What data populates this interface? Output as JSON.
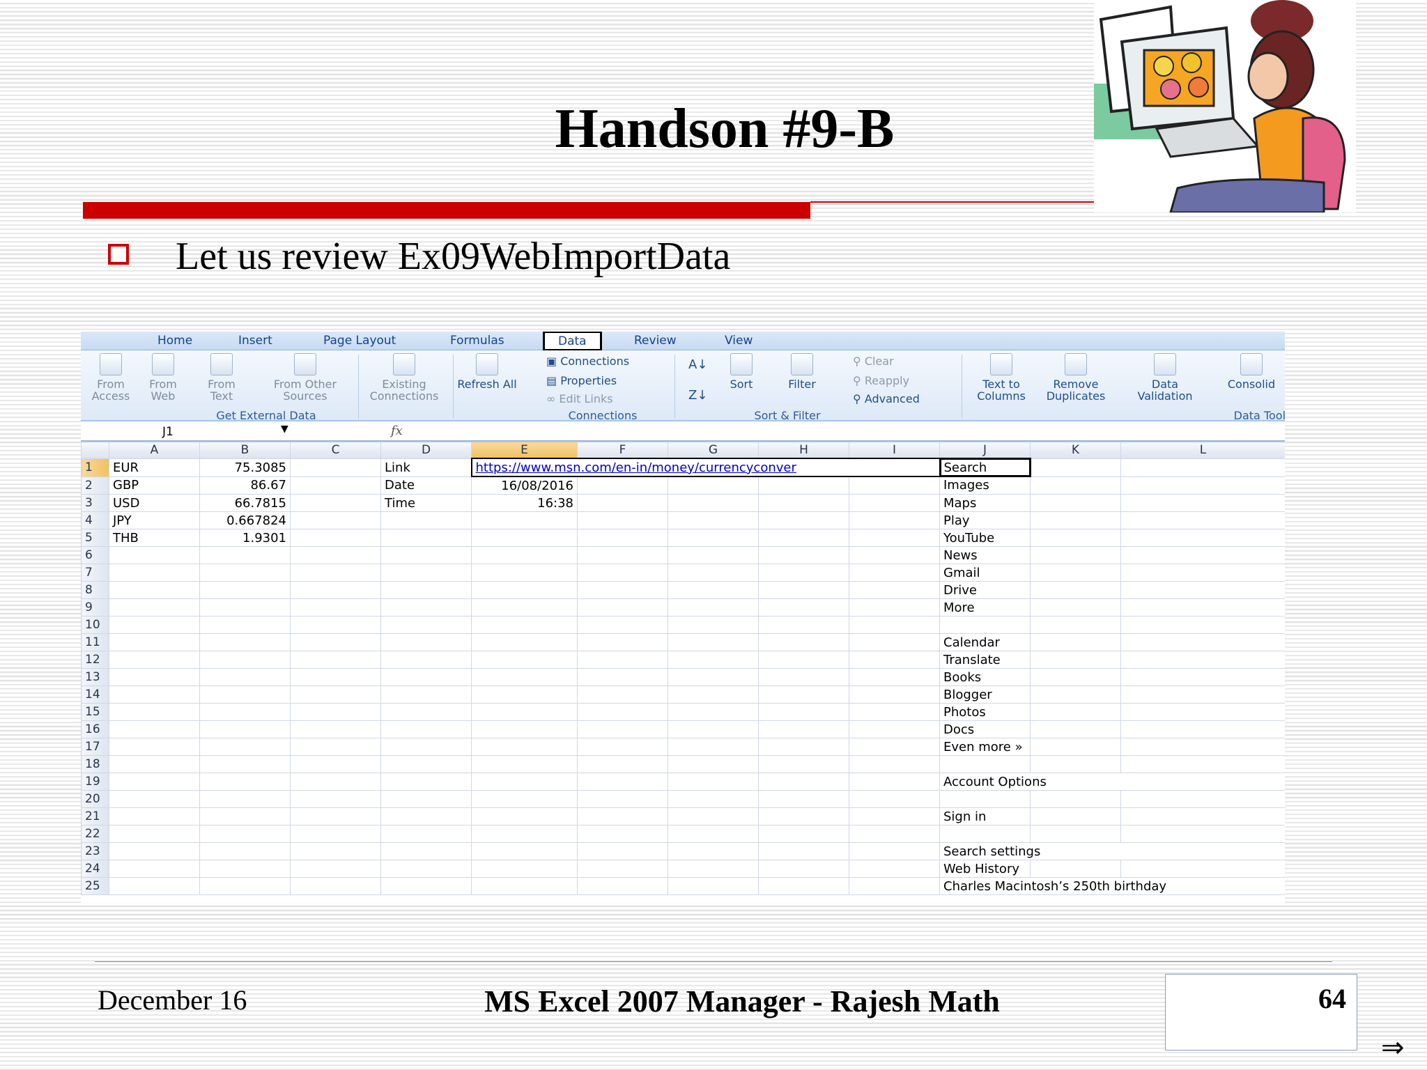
{
  "slide": {
    "title": "Handson #9-B",
    "bullet": "Let us review Ex09WebImportData",
    "footer_date": "December 16",
    "footer_center": "MS Excel 2007 Manager - Rajesh Math",
    "page_number": "64",
    "nav_arrow": "⇒",
    "accent_color": "#cc0000"
  },
  "excel": {
    "tabs": [
      "Home",
      "Insert",
      "Page Layout",
      "Formulas",
      "Data",
      "Review",
      "View"
    ],
    "active_tab": "Data",
    "ribbon": {
      "from_access": "From Access",
      "from_web": "From Web",
      "from_text": "From Text",
      "from_other": "From Other Sources",
      "existing": "Existing Connections",
      "get_external": "Get External Data",
      "refresh_all": "Refresh All",
      "connections": "Connections",
      "properties": "Properties",
      "edit_links": "Edit Links",
      "connections_group": "Connections",
      "sort": "Sort",
      "filter": "Filter",
      "clear": "Clear",
      "reapply": "Reapply",
      "advanced": "Advanced",
      "sort_filter_group": "Sort & Filter",
      "text_to_columns": "Text to Columns",
      "remove_duplicates": "Remove Duplicates",
      "data_validation": "Data Validation",
      "consolidate": "Consolid",
      "data_tools_group": "Data Tools"
    },
    "name_box": "J1",
    "fx_label": "fx",
    "columns": [
      "A",
      "B",
      "C",
      "D",
      "E",
      "F",
      "G",
      "H",
      "I",
      "J",
      "K",
      "L"
    ],
    "rows": [
      [
        "EUR",
        "75.3085",
        "",
        "Link",
        "https://www.msn.com/en-in/money/currencyconver",
        "",
        "",
        "",
        "",
        "Search",
        "",
        ""
      ],
      [
        "GBP",
        "86.67",
        "",
        "Date",
        "16/08/2016",
        "",
        "",
        "",
        "",
        "Images",
        "",
        ""
      ],
      [
        "USD",
        "66.7815",
        "",
        "Time",
        "16:38",
        "",
        "",
        "",
        "",
        "Maps",
        "",
        ""
      ],
      [
        "JPY",
        "0.667824",
        "",
        "",
        "",
        "",
        "",
        "",
        "",
        "Play",
        "",
        ""
      ],
      [
        "THB",
        "1.9301",
        "",
        "",
        "",
        "",
        "",
        "",
        "",
        "YouTube",
        "",
        ""
      ],
      [
        "",
        "",
        "",
        "",
        "",
        "",
        "",
        "",
        "",
        "News",
        "",
        ""
      ],
      [
        "",
        "",
        "",
        "",
        "",
        "",
        "",
        "",
        "",
        "Gmail",
        "",
        ""
      ],
      [
        "",
        "",
        "",
        "",
        "",
        "",
        "",
        "",
        "",
        "Drive",
        "",
        ""
      ],
      [
        "",
        "",
        "",
        "",
        "",
        "",
        "",
        "",
        "",
        "More",
        "",
        ""
      ],
      [
        "",
        "",
        "",
        "",
        "",
        "",
        "",
        "",
        "",
        "",
        "",
        ""
      ],
      [
        "",
        "",
        "",
        "",
        "",
        "",
        "",
        "",
        "",
        "Calendar",
        "",
        ""
      ],
      [
        "",
        "",
        "",
        "",
        "",
        "",
        "",
        "",
        "",
        "Translate",
        "",
        ""
      ],
      [
        "",
        "",
        "",
        "",
        "",
        "",
        "",
        "",
        "",
        "Books",
        "",
        ""
      ],
      [
        "",
        "",
        "",
        "",
        "",
        "",
        "",
        "",
        "",
        "Blogger",
        "",
        ""
      ],
      [
        "",
        "",
        "",
        "",
        "",
        "",
        "",
        "",
        "",
        "Photos",
        "",
        ""
      ],
      [
        "",
        "",
        "",
        "",
        "",
        "",
        "",
        "",
        "",
        "Docs",
        "",
        ""
      ],
      [
        "",
        "",
        "",
        "",
        "",
        "",
        "",
        "",
        "",
        "Even more »",
        "",
        ""
      ],
      [
        "",
        "",
        "",
        "",
        "",
        "",
        "",
        "",
        "",
        "",
        "",
        ""
      ],
      [
        "",
        "",
        "",
        "",
        "",
        "",
        "",
        "",
        "",
        "Account Options",
        "",
        ""
      ],
      [
        "",
        "",
        "",
        "",
        "",
        "",
        "",
        "",
        "",
        "",
        "",
        ""
      ],
      [
        "",
        "",
        "",
        "",
        "",
        "",
        "",
        "",
        "",
        "Sign in",
        "",
        ""
      ],
      [
        "",
        "",
        "",
        "",
        "",
        "",
        "",
        "",
        "",
        "",
        "",
        ""
      ],
      [
        "",
        "",
        "",
        "",
        "",
        "",
        "",
        "",
        "",
        "Search settings",
        "",
        ""
      ],
      [
        "",
        "",
        "",
        "",
        "",
        "",
        "",
        "",
        "",
        "Web History",
        "",
        ""
      ],
      [
        "",
        "",
        "",
        "",
        "",
        "",
        "",
        "",
        "",
        "Charles Macintosh’s 250th birthday",
        "",
        ""
      ]
    ]
  }
}
